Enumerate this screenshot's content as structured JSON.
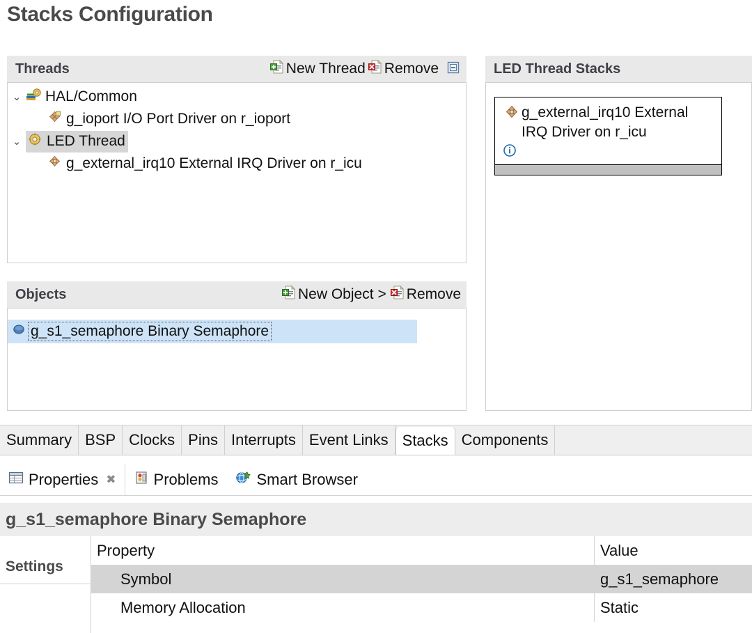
{
  "page": {
    "title": "Stacks Configuration"
  },
  "threads_panel": {
    "title": "Threads",
    "actions": {
      "new_thread": "New Thread",
      "remove": "Remove",
      "collapse_icon": "collapse-all-icon"
    },
    "tree": [
      {
        "label": "HAL/Common",
        "icon": "hal-common-icon",
        "level": 0,
        "expanded": true,
        "twisty": "⌄",
        "selected": false
      },
      {
        "label": "g_ioport I/O Port Driver on r_ioport",
        "icon": "module-icon",
        "level": 1,
        "expanded": false,
        "twisty": "",
        "selected": false
      },
      {
        "label": "LED Thread",
        "icon": "thread-icon",
        "level": 0,
        "expanded": true,
        "twisty": "⌄",
        "selected": true
      },
      {
        "label": "g_external_irq10 External IRQ Driver on r_icu",
        "icon": "module-icon",
        "level": 1,
        "expanded": false,
        "twisty": "",
        "selected": false
      }
    ]
  },
  "objects_panel": {
    "title": "Objects",
    "actions": {
      "new_object": "New Object",
      "separator": ">",
      "remove": "Remove"
    },
    "items": [
      {
        "label": "g_s1_semaphore Binary Semaphore",
        "icon": "semaphore-icon",
        "selected": true,
        "editing": true
      }
    ]
  },
  "stacks_panel": {
    "title": "LED Thread Stacks",
    "module": {
      "label": "g_external_irq10 External IRQ Driver on r_icu",
      "icon": "module-icon",
      "info_icon": "info-icon"
    }
  },
  "config_tabs": {
    "items": [
      {
        "label": "Summary",
        "active": false
      },
      {
        "label": "BSP",
        "active": false
      },
      {
        "label": "Clocks",
        "active": false
      },
      {
        "label": "Pins",
        "active": false
      },
      {
        "label": "Interrupts",
        "active": false
      },
      {
        "label": "Event Links",
        "active": false
      },
      {
        "label": "Stacks",
        "active": true
      },
      {
        "label": "Components",
        "active": false
      }
    ]
  },
  "view_tabs": {
    "items": [
      {
        "label": "Properties",
        "icon": "properties-table-icon",
        "active": true,
        "closable": true
      },
      {
        "label": "Problems",
        "icon": "problems-icon",
        "active": false,
        "closable": false
      },
      {
        "label": "Smart Browser",
        "icon": "smart-browser-icon",
        "active": false,
        "closable": false
      }
    ]
  },
  "properties_view": {
    "header_title": "g_s1_semaphore Binary Semaphore",
    "side_tab": "Settings",
    "columns": {
      "property": "Property",
      "value": "Value"
    },
    "rows": [
      {
        "property": "Symbol",
        "value": "g_s1_semaphore",
        "selected": true
      },
      {
        "property": "Memory Allocation",
        "value": "Static",
        "selected": false
      }
    ]
  },
  "colors": {
    "header_bg": "#e9e9e9",
    "selection_blue": "#cde3f7",
    "selection_gray": "#d4d4d4",
    "title_text": "#4a4a4a",
    "module_icon": "#c98b5e",
    "info_icon": "#1d6aa8"
  }
}
